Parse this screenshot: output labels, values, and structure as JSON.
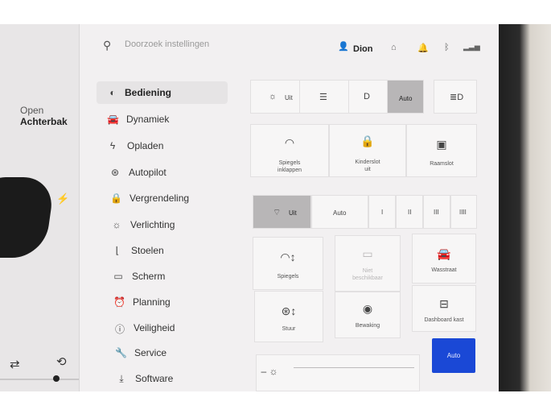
{
  "header": {
    "search_placeholder": "Doorzoek instellingen",
    "user_name": "Dion"
  },
  "car_panel": {
    "trunk_line1": "Open",
    "trunk_line2": "Achterbak"
  },
  "sidebar": {
    "items": [
      {
        "label": "Bediening",
        "icon": "toggle-icon",
        "active": true
      },
      {
        "label": "Dynamiek",
        "icon": "car-icon",
        "active": false
      },
      {
        "label": "Opladen",
        "icon": "bolt-icon",
        "active": false
      },
      {
        "label": "Autopilot",
        "icon": "steering-wheel-icon",
        "active": false
      },
      {
        "label": "Vergrendeling",
        "icon": "lock-icon",
        "active": false
      },
      {
        "label": "Verlichting",
        "icon": "sun-icon",
        "active": false
      },
      {
        "label": "Stoelen",
        "icon": "seat-icon",
        "active": false
      },
      {
        "label": "Scherm",
        "icon": "display-icon",
        "active": false
      },
      {
        "label": "Planning",
        "icon": "alarm-clock-icon",
        "active": false
      },
      {
        "label": "Veiligheid",
        "icon": "info-icon",
        "active": false
      },
      {
        "label": "Service",
        "icon": "wrench-icon",
        "active": false
      },
      {
        "label": "Software",
        "icon": "download-icon",
        "active": false
      }
    ]
  },
  "lights": {
    "off_label": "Uit",
    "auto_label": "Auto",
    "selected": "Auto"
  },
  "tiles": {
    "fold_mirrors": [
      "Spiegels",
      "inklappen"
    ],
    "child_lock": [
      "Kinderslot",
      "uit"
    ],
    "window_lock": "Raamslot"
  },
  "wipers": {
    "off_label": "Uit",
    "auto_label": "Auto",
    "speeds": [
      "I",
      "II",
      "III",
      "IIII"
    ],
    "selected": "Uit"
  },
  "adjust": {
    "mirrors": "Spiegels",
    "steering": "Stuur",
    "unavailable": [
      "Niet",
      "beschikbaar"
    ],
    "guard": "Bewaking",
    "car_wash": "Wasstraat",
    "dashcam": "Dashboard kast"
  },
  "brightness": {
    "auto_label": "Auto"
  },
  "colors": {
    "accent": "#1a48d6",
    "selected_segment": "#b8b6b7",
    "screen_background": "#f2f0f1"
  }
}
